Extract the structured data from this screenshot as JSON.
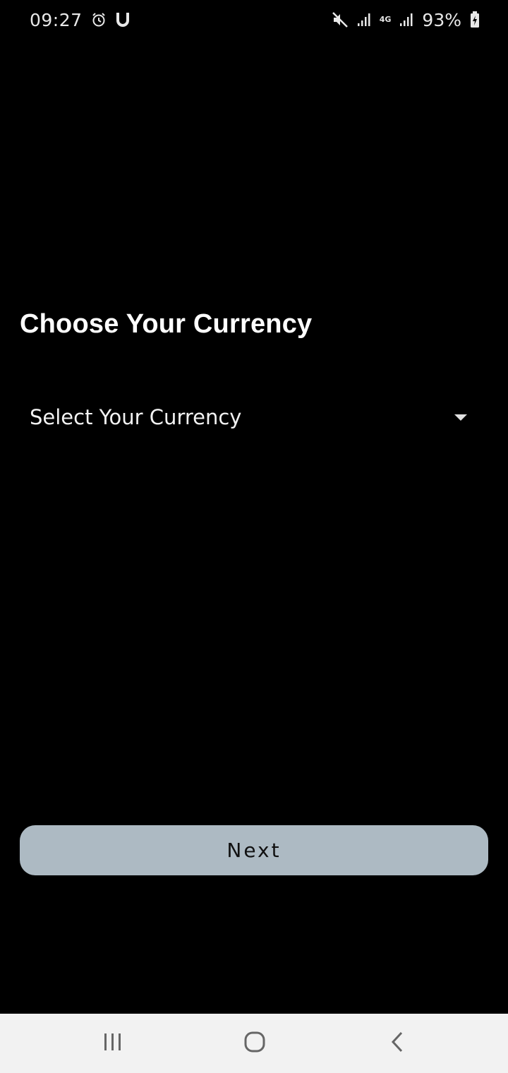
{
  "status_bar": {
    "time": "09:27",
    "battery_percent": "93%",
    "network_type": "4G",
    "icons": [
      "alarm-icon",
      "u-app-icon",
      "mute-icon",
      "signal-icon",
      "signal-icon",
      "battery-charging-icon"
    ]
  },
  "screen": {
    "title": "Choose Your Currency",
    "currency_select": {
      "placeholder": "Select Your Currency"
    },
    "next_label": "Next"
  },
  "nav_bar": {
    "icons": [
      "recent-apps-icon",
      "home-icon",
      "back-icon"
    ]
  },
  "colors": {
    "background": "#000000",
    "button": "#adbac3",
    "nav_bar": "#f2f2f2"
  }
}
